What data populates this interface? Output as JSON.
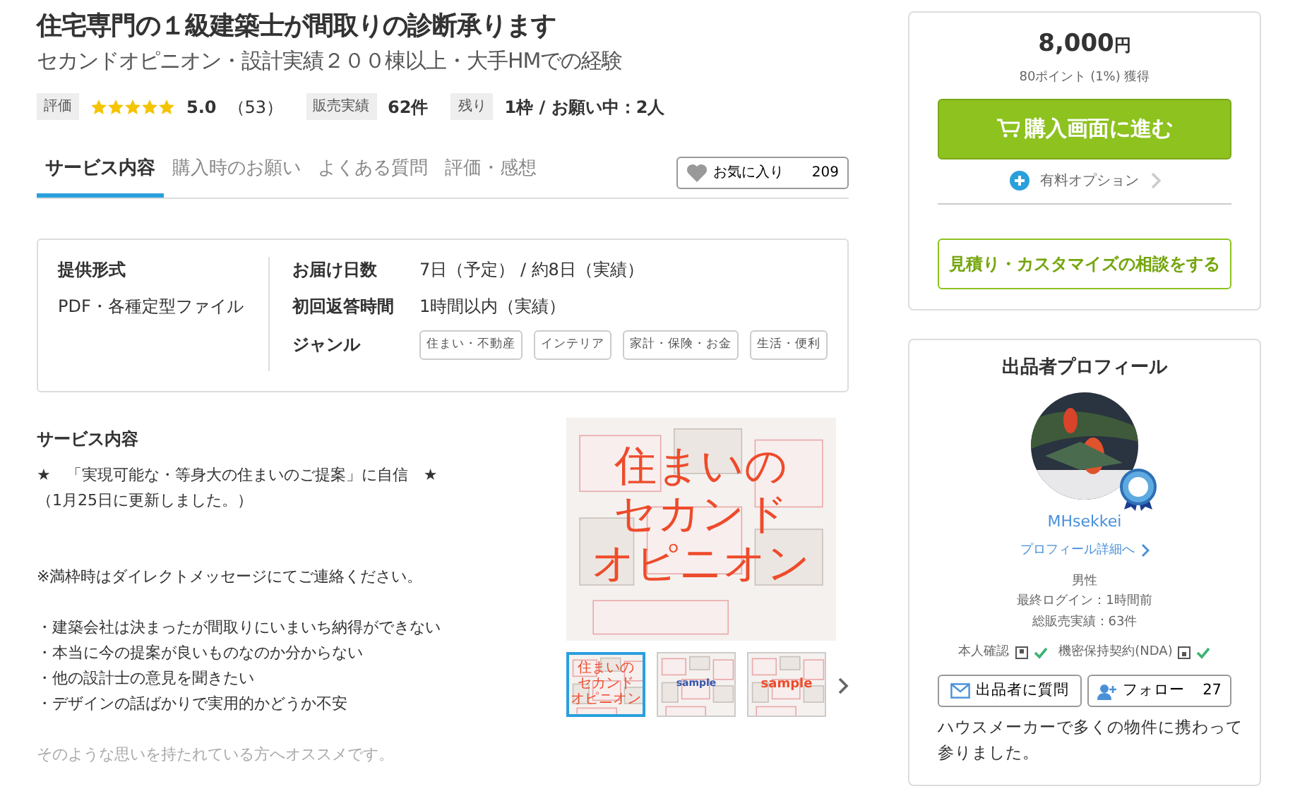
{
  "title": "住宅専門の１級建築士が間取りの診断承ります",
  "subtitle": "セカンドオピニオン・設計実績２００棟以上・大手HMでの経験",
  "stats": [
    {
      "kind": "rating",
      "label": "評価",
      "stars": 5,
      "score": "5.0",
      "count": "（53）"
    },
    {
      "kind": "text",
      "label": "販売実績",
      "value": "62件"
    },
    {
      "kind": "text",
      "label": "残り",
      "value": "1枠 / お願い中：2人"
    }
  ],
  "tabs": [
    {
      "label": "サービス内容",
      "selected": true
    },
    {
      "label": "購入時のお願い",
      "selected": false
    },
    {
      "label": "よくある質問",
      "selected": false
    },
    {
      "label": "評価・感想",
      "selected": false
    }
  ],
  "favorite": {
    "label": "お気に入り",
    "count": "209"
  },
  "info": {
    "format_label": "提供形式",
    "format_value": "PDF・各種定型ファイル",
    "rows": [
      {
        "kind": "text",
        "label": "お届け日数",
        "value": "7日（予定） / 約8日（実績）"
      },
      {
        "kind": "text",
        "label": "初回返答時間",
        "value": "1時間以内（実績）"
      },
      {
        "kind": "tags",
        "label": "ジャンル",
        "tags": [
          "住まい・不動産",
          "インテリア",
          "家計・保険・お金",
          "生活・便利"
        ]
      }
    ]
  },
  "description": {
    "heading": "サービス内容",
    "lines": [
      {
        "text": "★　「実現可能な・等身大の住まいのご提案」に自信　★",
        "kind": "line",
        "faded": false
      },
      {
        "text": "（1月25日に更新しました。）",
        "kind": "line",
        "faded": false
      },
      {
        "text": "※満枠時はダイレクトメッセージにてご連絡ください。",
        "kind": "after_double_gap",
        "faded": false
      },
      {
        "text": "・建築会社は決まったが間取りにいまいち納得ができない",
        "kind": "after_gap",
        "faded": false
      },
      {
        "text": "・本当に今の提案が良いものなのか分からない",
        "kind": "line",
        "faded": false
      },
      {
        "text": "・他の設計士の意見を聞きたい",
        "kind": "line",
        "faded": false
      },
      {
        "text": "・デザインの話ばかりで実用的かどうか不安",
        "kind": "line",
        "faded": false
      },
      {
        "text": "そのような思いを持たれている方へオススメです。",
        "kind": "after_gap",
        "faded": true
      }
    ]
  },
  "gallery": {
    "caption_lines": [
      "住まいの",
      "セカンド",
      "オピニオン"
    ],
    "thumbnails": [
      {
        "kind": "caption",
        "lines": [
          "住まいの",
          "セカンド",
          "オピニオン"
        ],
        "selected": true
      },
      {
        "kind": "sample",
        "lines": [
          "sample"
        ],
        "selected": false
      },
      {
        "kind": "sample",
        "lines": [
          "sample"
        ],
        "selected": false
      }
    ]
  },
  "purchase": {
    "price": "8,000",
    "currency": "円",
    "points": "80ポイント (1%) 獲得",
    "buy": "購入画面に進む",
    "option": "有料オプション",
    "consult": "見積り・カスタマイズの相談をする"
  },
  "profile": {
    "heading": "出品者プロフィール",
    "name": "MHsekkei",
    "detail": "プロフィール詳細へ",
    "facts": [
      "男性",
      "最終ログイン：1時間前",
      "総販売実績：63件"
    ],
    "checks": [
      {
        "label": "本人確認",
        "verified": true
      },
      {
        "label": "機密保持契約(NDA)",
        "verified": true
      }
    ],
    "ask": "出品者に質問",
    "follow": "フォロー",
    "followers": "27",
    "bio_lines": [
      "ハウスメーカーで多くの物件に携わって",
      "参りました。"
    ]
  }
}
